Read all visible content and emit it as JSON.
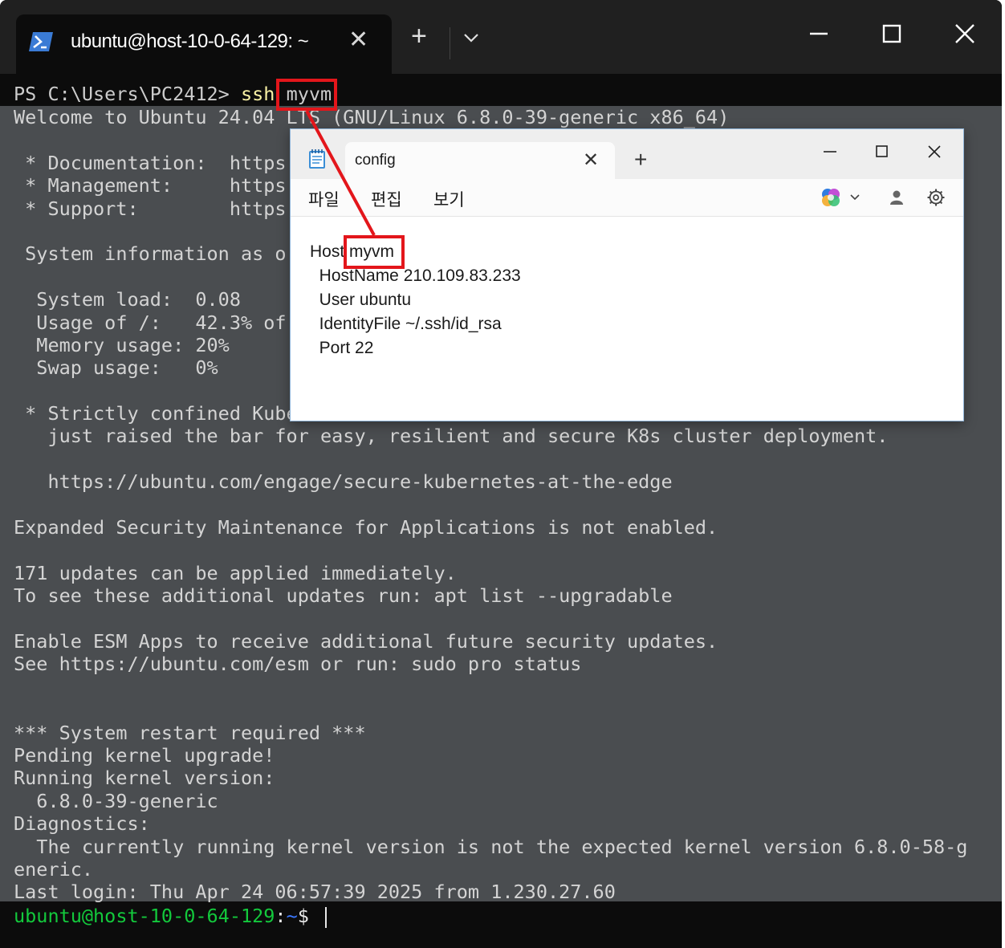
{
  "terminal": {
    "tab_title": "ubuntu@host-10-0-64-129: ~",
    "prompt_prefix": "PS C:\\Users\\PC2412> ",
    "ssh_cmd": "ssh",
    "ssh_host": "myvm",
    "output_lines": [
      "Welcome to Ubuntu 24.04 LTS (GNU/Linux 6.8.0-39-generic x86_64)",
      "",
      " * Documentation:  https",
      " * Management:     https",
      " * Support:        https",
      "",
      " System information as o",
      "",
      "  System load:  0.08",
      "  Usage of /:   42.3% of",
      "  Memory usage: 20%",
      "  Swap usage:   0%",
      "",
      " * Strictly confined Kube",
      "   just raised the bar for easy, resilient and secure K8s cluster deployment.",
      "",
      "   https://ubuntu.com/engage/secure-kubernetes-at-the-edge",
      "",
      "Expanded Security Maintenance for Applications is not enabled.",
      "",
      "171 updates can be applied immediately.",
      "To see these additional updates run: apt list --upgradable",
      "",
      "Enable ESM Apps to receive additional future security updates.",
      "See https://ubuntu.com/esm or run: sudo pro status",
      "",
      "",
      "*** System restart required ***",
      "Pending kernel upgrade!",
      "Running kernel version:",
      "  6.8.0-39-generic",
      "Diagnostics:",
      "  The currently running kernel version is not the expected kernel version 6.8.0-58-g",
      "eneric.",
      "Last login: Thu Apr 24 06:57:39 2025 from 1.230.27.60"
    ],
    "final_prompt_user": "ubuntu@host-10-0-64-129",
    "final_prompt_colon": ":",
    "final_prompt_path": "~",
    "final_prompt_symbol": "$ "
  },
  "notepad": {
    "tab_title": "config",
    "menu": [
      "파일",
      "편집",
      "보기"
    ],
    "lines": [
      {
        "key": "Host",
        "value": "myvm"
      },
      {
        "text": "  HostName 210.109.83.233"
      },
      {
        "text": "  User ubuntu"
      },
      {
        "text": "  IdentityFile ~/.ssh/id_rsa"
      },
      {
        "text": "  Port 22"
      }
    ]
  },
  "colors": {
    "highlight": "#e3161b",
    "terminal_bg": "#0c0c0c",
    "output_bg": "#4a4d50",
    "prompt_user": "#13c93c",
    "prompt_path": "#3b78ff"
  }
}
